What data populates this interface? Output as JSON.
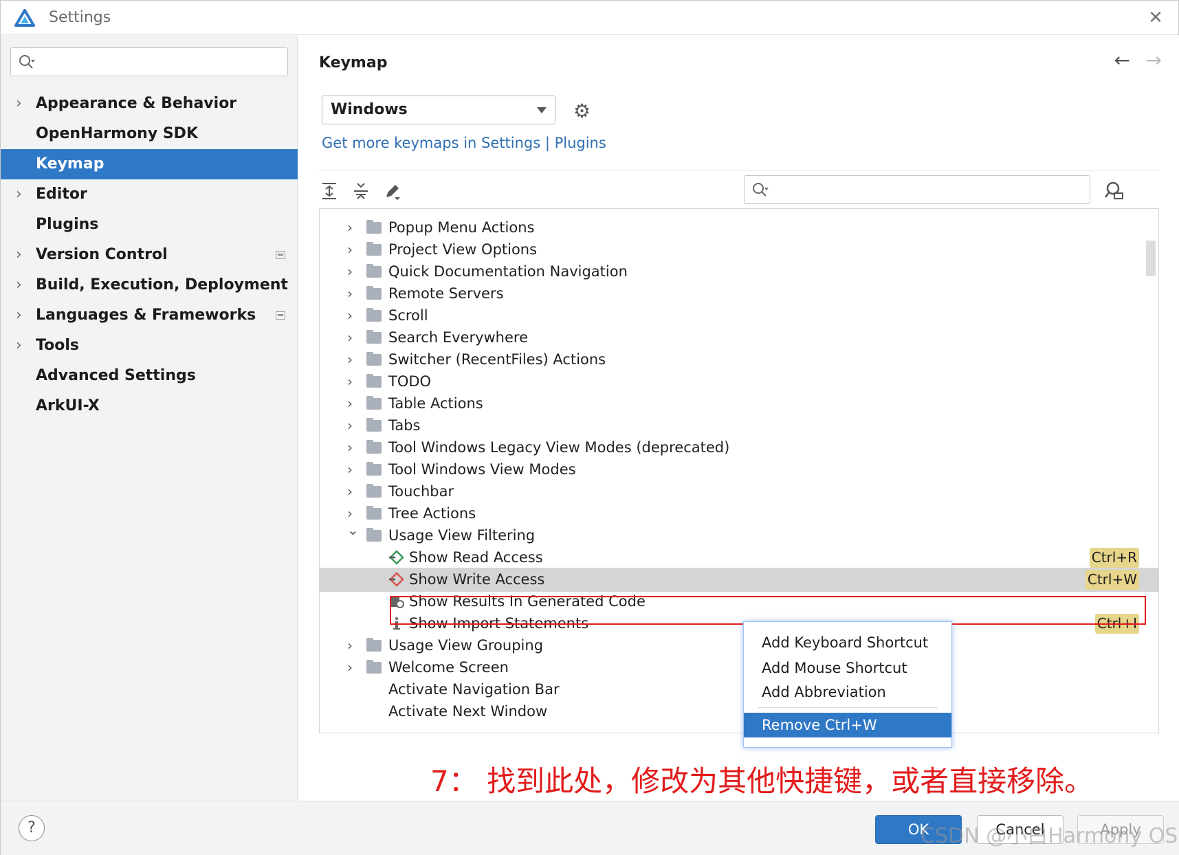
{
  "window": {
    "title": "Settings"
  },
  "sidebar": {
    "search_placeholder": "",
    "items": [
      {
        "label": "Appearance & Behavior",
        "expandable": true,
        "selected": false
      },
      {
        "label": "OpenHarmony SDK",
        "expandable": false,
        "selected": false
      },
      {
        "label": "Keymap",
        "expandable": false,
        "selected": true
      },
      {
        "label": "Editor",
        "expandable": true,
        "selected": false
      },
      {
        "label": "Plugins",
        "expandable": false,
        "selected": false
      },
      {
        "label": "Version Control",
        "expandable": true,
        "selected": false
      },
      {
        "label": "Build, Execution, Deployment",
        "expandable": true,
        "selected": false
      },
      {
        "label": "Languages & Frameworks",
        "expandable": true,
        "selected": false
      },
      {
        "label": "Tools",
        "expandable": true,
        "selected": false
      },
      {
        "label": "Advanced Settings",
        "expandable": false,
        "selected": false
      },
      {
        "label": "ArkUI-X",
        "expandable": false,
        "selected": false
      }
    ]
  },
  "main": {
    "title": "Keymap",
    "keymap_select": {
      "value": "Windows"
    },
    "plugins_link": "Get more keymaps in Settings | Plugins",
    "action_search_placeholder": ""
  },
  "tree": {
    "rows": [
      {
        "label": "Popup Menu Actions",
        "level": 0,
        "type": "folder",
        "chevron": ">"
      },
      {
        "label": "Project View Options",
        "level": 0,
        "type": "folder",
        "chevron": ">"
      },
      {
        "label": "Quick Documentation Navigation",
        "level": 0,
        "type": "folder",
        "chevron": ">"
      },
      {
        "label": "Remote Servers",
        "level": 0,
        "type": "folder",
        "chevron": ">"
      },
      {
        "label": "Scroll",
        "level": 0,
        "type": "folder",
        "chevron": ">"
      },
      {
        "label": "Search Everywhere",
        "level": 0,
        "type": "folder",
        "chevron": ">"
      },
      {
        "label": "Switcher (RecentFiles) Actions",
        "level": 0,
        "type": "folder",
        "chevron": ">"
      },
      {
        "label": "TODO",
        "level": 0,
        "type": "folder",
        "chevron": ">"
      },
      {
        "label": "Table Actions",
        "level": 0,
        "type": "folder",
        "chevron": ">"
      },
      {
        "label": "Tabs",
        "level": 0,
        "type": "folder",
        "chevron": ">"
      },
      {
        "label": "Tool Windows Legacy View Modes (deprecated)",
        "level": 0,
        "type": "folder",
        "chevron": ">"
      },
      {
        "label": "Tool Windows View Modes",
        "level": 0,
        "type": "folder",
        "chevron": ">"
      },
      {
        "label": "Touchbar",
        "level": 0,
        "type": "folder",
        "chevron": ">"
      },
      {
        "label": "Tree Actions",
        "level": 0,
        "type": "folder",
        "chevron": ">"
      },
      {
        "label": "Usage View Filtering",
        "level": 0,
        "type": "folder",
        "chevron": "v"
      },
      {
        "label": "Show Read Access",
        "level": 1,
        "type": "action",
        "icon": "read-access-icon",
        "shortcut": "Ctrl+R"
      },
      {
        "label": "Show Write Access",
        "level": 1,
        "type": "action",
        "icon": "write-access-icon",
        "shortcut": "Ctrl+W",
        "selected": true
      },
      {
        "label": "Show Results In Generated Code",
        "level": 1,
        "type": "action",
        "icon": "generated-code-icon"
      },
      {
        "label": "Show Import Statements",
        "level": 1,
        "type": "action",
        "icon": "info-icon",
        "shortcut": "Ctrl+I"
      },
      {
        "label": "Usage View Grouping",
        "level": 0,
        "type": "folder",
        "chevron": ">"
      },
      {
        "label": "Welcome Screen",
        "level": 0,
        "type": "folder",
        "chevron": ">"
      },
      {
        "label": "Activate Navigation Bar",
        "level": 0,
        "type": "plain"
      },
      {
        "label": "Activate Next Window",
        "level": 0,
        "type": "plain"
      }
    ]
  },
  "context_menu": {
    "items": [
      {
        "label": "Add Keyboard Shortcut",
        "selected": false
      },
      {
        "label": "Add Mouse Shortcut",
        "selected": false
      },
      {
        "label": "Add Abbreviation",
        "selected": false
      },
      {
        "label": "Remove Ctrl+W",
        "selected": true
      }
    ]
  },
  "annotation": "7： 找到此处，修改为其他快捷键，或者直接移除。",
  "footer": {
    "help_label": "?",
    "ok_label": "OK",
    "cancel_label": "Cancel",
    "apply_label": "Apply"
  },
  "watermark": "CSDN @小白Harmony OS",
  "colors": {
    "accent": "#2f78c6",
    "shortcut_highlight": "#e6d58a",
    "annotation_red": "#e21b1b",
    "link": "#2f6fb3"
  }
}
